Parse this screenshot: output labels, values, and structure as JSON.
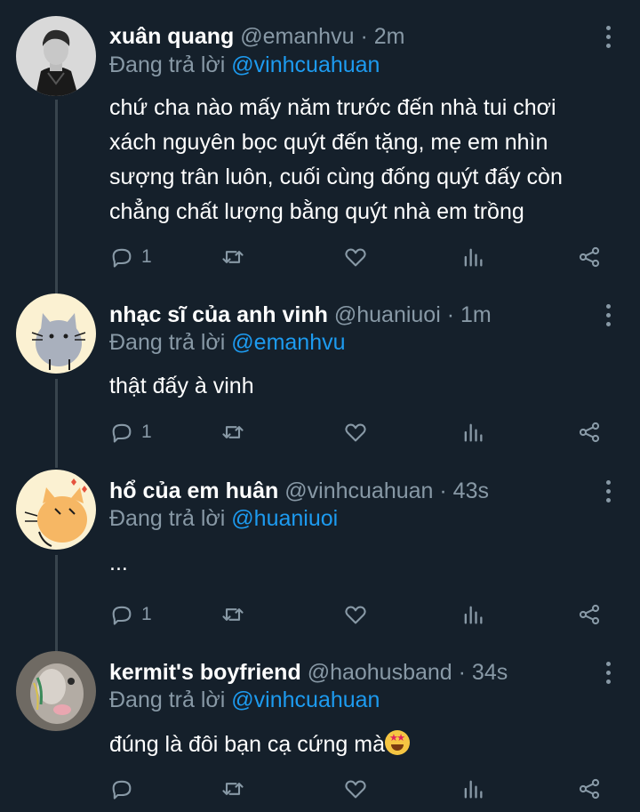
{
  "replying_prefix": "Đang trả lời",
  "colors": {
    "background": "#15202b",
    "secondary_text": "#8899a6",
    "mention": "#1d9bf0",
    "thread_line": "#38444d"
  },
  "icons": {
    "reply": "reply-icon",
    "retweet": "retweet-icon",
    "like": "like-icon",
    "analytics": "analytics-icon",
    "share": "share-icon",
    "more": "more-options-icon"
  },
  "tweets": [
    {
      "name": "xuân quang",
      "handle": "@emanhvu",
      "time": "· 2m",
      "replying_to": "@vinhcuahuan",
      "lines": [
        "chứ cha nào mấy năm trước đến nhà tui chơi",
        "xách nguyên bọc quýt đến tặng, mẹ em nhìn",
        "sượng trân luôn, cuối cùng đống quýt đấy còn",
        "chẳng chất lượng bằng quýt nhà em trồng"
      ],
      "reply_count": "1"
    },
    {
      "name": "nhạc sĩ của anh vinh",
      "handle": "@huaniuoi",
      "time": "· 1m",
      "replying_to": "@emanhvu",
      "lines": [
        "thật đấy à vinh"
      ],
      "reply_count": "1"
    },
    {
      "name": "hổ của em huân",
      "handle": "@vinhcuahuan",
      "time": "· 43s",
      "replying_to": "@huaniuoi",
      "lines": [
        "..."
      ],
      "reply_count": "1"
    },
    {
      "name": "kermit's boyfriend",
      "handle": "@haohusband",
      "time": "· 34s",
      "replying_to": "@vinhcuahuan",
      "lines": [
        "đúng là đôi bạn cạ cứng mà"
      ],
      "reply_count": ""
    }
  ]
}
